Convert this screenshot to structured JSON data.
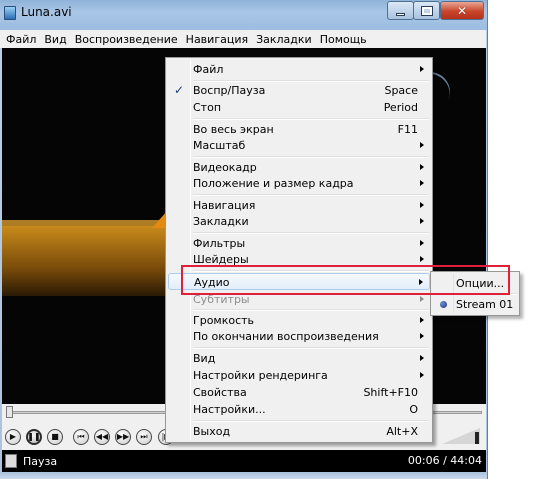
{
  "window": {
    "title": "Luna.avi",
    "icon": "media-player-icon"
  },
  "menubar": {
    "items": [
      "Файл",
      "Вид",
      "Воспроизведение",
      "Навигация",
      "Закладки",
      "Помощь"
    ]
  },
  "context_menu": {
    "items": [
      {
        "label": "Файл",
        "submenu": true
      },
      {
        "label": "Воспр/Пауза",
        "shortcut": "Space",
        "checked": true
      },
      {
        "label": "Стоп",
        "shortcut": "Period"
      },
      {
        "label": "Во весь экран",
        "shortcut": "F11"
      },
      {
        "label": "Масштаб",
        "submenu": true
      },
      {
        "label": "Видеокадр",
        "submenu": true
      },
      {
        "label": "Положение и размер кадра",
        "submenu": true
      },
      {
        "label": "Навигация",
        "submenu": true
      },
      {
        "label": "Закладки",
        "submenu": true
      },
      {
        "label": "Фильтры",
        "submenu": true
      },
      {
        "label": "Шейдеры",
        "submenu": true
      },
      {
        "label": "Аудио",
        "submenu": true,
        "highlighted": true
      },
      {
        "label": "Субтитры",
        "submenu": true,
        "disabled": true
      },
      {
        "label": "Громкость",
        "submenu": true
      },
      {
        "label": "По окончании воспроизведения",
        "submenu": true
      },
      {
        "label": "Вид",
        "submenu": true
      },
      {
        "label": "Настройки рендеринга",
        "submenu": true
      },
      {
        "label": "Свойства",
        "shortcut": "Shift+F10"
      },
      {
        "label": "Настройки...",
        "shortcut": "O"
      },
      {
        "label": "Выход",
        "shortcut": "Alt+X"
      }
    ]
  },
  "audio_submenu": {
    "items": [
      {
        "label": "Опции..."
      },
      {
        "label": "Stream 01",
        "selected": true
      }
    ]
  },
  "controls": {
    "buttons": [
      "play-icon",
      "pause-icon",
      "stop-icon",
      "prev-icon",
      "rewind-icon",
      "forward-icon",
      "next-icon",
      "frame-step-icon"
    ],
    "volume_fraction": 0.95
  },
  "status": {
    "state": "Пауза",
    "time": "00:06 / 44:04"
  },
  "colors": {
    "annotation": "#e0203a",
    "menu_highlight": "#aeccee"
  }
}
